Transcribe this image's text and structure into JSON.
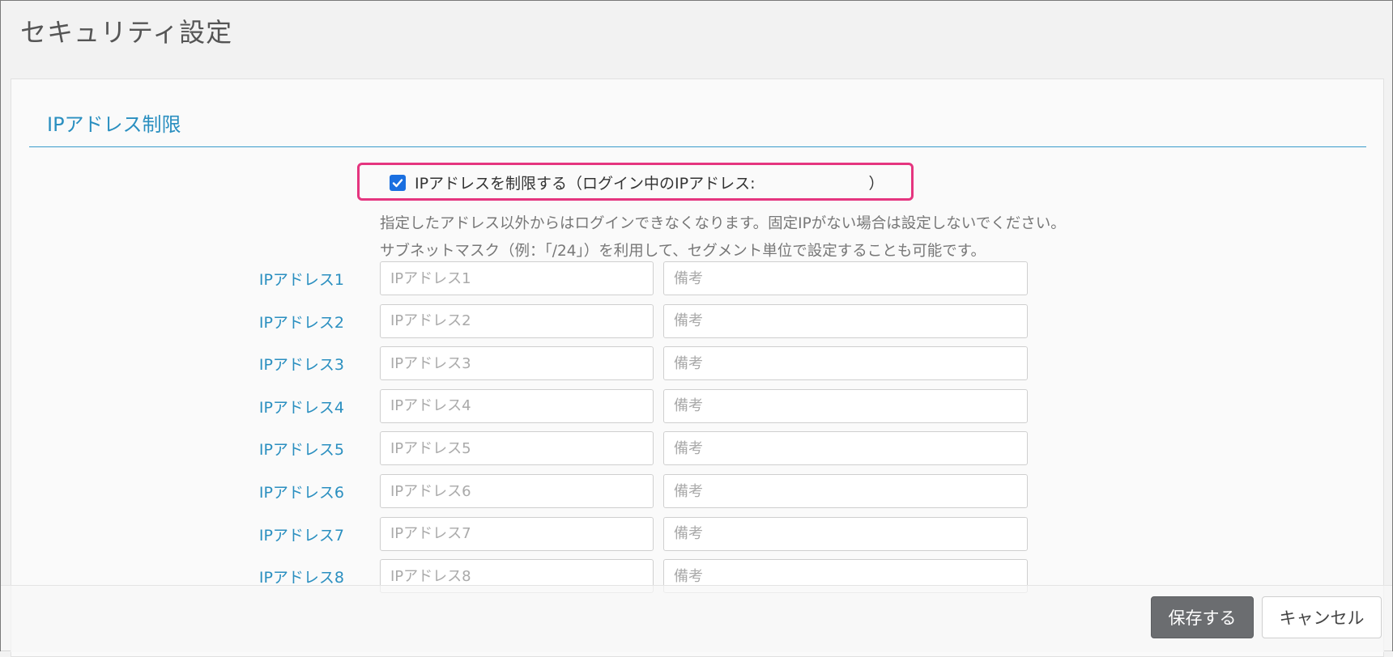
{
  "page": {
    "title": "セキュリティ設定"
  },
  "section": {
    "title": "IPアドレス制限"
  },
  "restriction": {
    "checked": true,
    "label_prefix": "IPアドレスを制限する（ログイン中のIPアドレス:",
    "current_ip": "",
    "label_suffix": "）"
  },
  "description": {
    "line1": "指定したアドレス以外からはログインできなくなります。固定IPがない場合は設定しないでください。",
    "line2": "サブネットマスク（例：「/24」）を利用して、セグメント単位で設定することも可能です。"
  },
  "rows": [
    {
      "label": "IPアドレス1",
      "ip_placeholder": "IPアドレス1",
      "ip_value": "",
      "note_placeholder": "備考",
      "note_value": ""
    },
    {
      "label": "IPアドレス2",
      "ip_placeholder": "IPアドレス2",
      "ip_value": "",
      "note_placeholder": "備考",
      "note_value": ""
    },
    {
      "label": "IPアドレス3",
      "ip_placeholder": "IPアドレス3",
      "ip_value": "",
      "note_placeholder": "備考",
      "note_value": ""
    },
    {
      "label": "IPアドレス4",
      "ip_placeholder": "IPアドレス4",
      "ip_value": "",
      "note_placeholder": "備考",
      "note_value": ""
    },
    {
      "label": "IPアドレス5",
      "ip_placeholder": "IPアドレス5",
      "ip_value": "",
      "note_placeholder": "備考",
      "note_value": ""
    },
    {
      "label": "IPアドレス6",
      "ip_placeholder": "IPアドレス6",
      "ip_value": "",
      "note_placeholder": "備考",
      "note_value": ""
    },
    {
      "label": "IPアドレス7",
      "ip_placeholder": "IPアドレス7",
      "ip_value": "",
      "note_placeholder": "備考",
      "note_value": ""
    },
    {
      "label": "IPアドレス8",
      "ip_placeholder": "IPアドレス8",
      "ip_value": "",
      "note_placeholder": "備考",
      "note_value": ""
    }
  ],
  "footer": {
    "save_label": "保存する",
    "cancel_label": "キャンセル"
  },
  "colors": {
    "accent": "#2a8fc0",
    "highlight": "#e5357f",
    "checkbox": "#1a6fe0",
    "save_button": "#6b6d70"
  },
  "icons": {
    "checkbox": "checkmark-icon"
  }
}
